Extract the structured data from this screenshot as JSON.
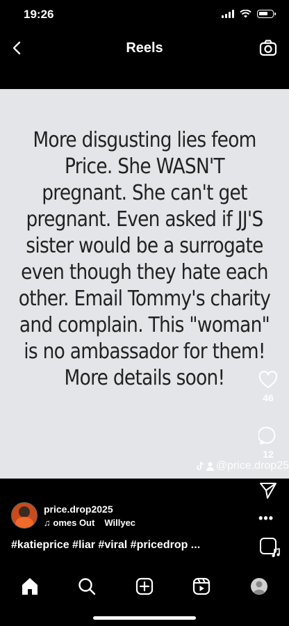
{
  "status": {
    "time": "19:26"
  },
  "nav": {
    "title": "Reels"
  },
  "reel": {
    "lines": [
      "More disgusting lies feom",
      "Price. She WASN'T",
      "pregnant. She can't get",
      "pregnant. Even asked if JJ'S",
      "sister would be a surrogate",
      "even though they hate each",
      "other. Email Tommy's charity",
      "and complain. This \"woman\"",
      "is no ambassador for them!",
      "More details soon!"
    ],
    "watermark": "@price.drop25"
  },
  "actions": {
    "likes": "46",
    "comments": "12"
  },
  "post": {
    "username": "price.drop2025",
    "music_left": "omes Out",
    "music_right": "Willyec",
    "music_icon": "♫",
    "caption": "#katieprice #liar #viral #pricedrop ...",
    "more": "•••"
  },
  "icons": [
    "back-icon",
    "camera-icon",
    "heart-icon",
    "comment-icon",
    "share-icon",
    "more-icon",
    "home-icon",
    "search-icon",
    "create-icon",
    "reels-icon",
    "profile-icon"
  ]
}
